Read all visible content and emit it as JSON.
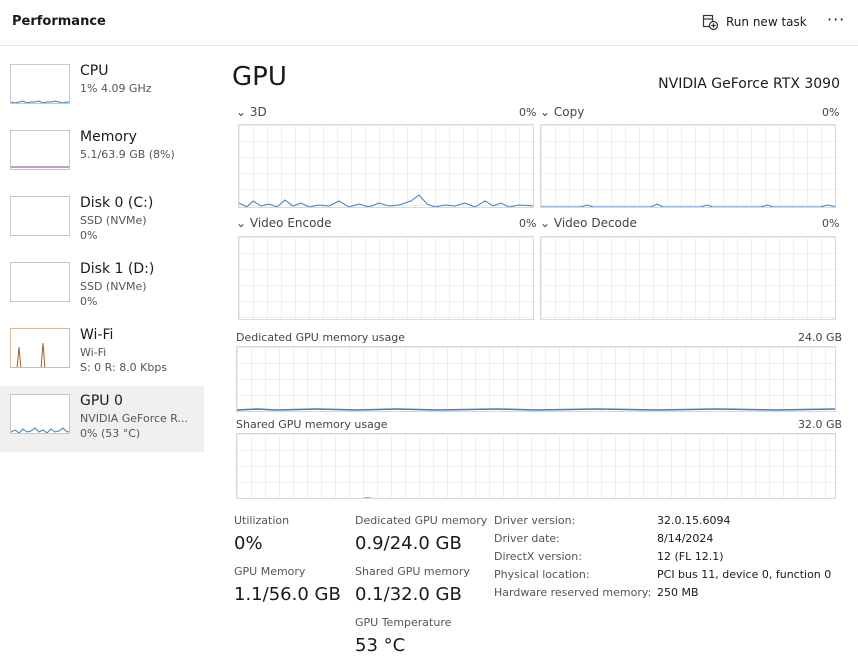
{
  "header": {
    "title": "Performance",
    "run_task_label": "Run new task",
    "more_label": "···"
  },
  "sidebar": {
    "items": [
      {
        "name": "CPU",
        "line1": "1%  4.09 GHz",
        "line2": ""
      },
      {
        "name": "Memory",
        "line1": "5.1/63.9 GB (8%)",
        "line2": ""
      },
      {
        "name": "Disk 0 (C:)",
        "line1": "SSD (NVMe)",
        "line2": "0%"
      },
      {
        "name": "Disk 1 (D:)",
        "line1": "SSD (NVMe)",
        "line2": "0%"
      },
      {
        "name": "Wi-Fi",
        "line1": "Wi-Fi",
        "line2": "S: 0  R: 8.0 Kbps"
      },
      {
        "name": "GPU 0",
        "line1": "NVIDIA GeForce R...",
        "line2": "0%  (53 °C)"
      }
    ]
  },
  "main": {
    "title": "GPU",
    "model": "NVIDIA GeForce RTX 3090",
    "engines": [
      {
        "label": "3D",
        "pct": "0%"
      },
      {
        "label": "Copy",
        "pct": "0%"
      },
      {
        "label": "Video Encode",
        "pct": "0%"
      },
      {
        "label": "Video Decode",
        "pct": "0%"
      }
    ],
    "dedicated_label": "Dedicated GPU memory usage",
    "dedicated_max": "24.0 GB",
    "shared_label": "Shared GPU memory usage",
    "shared_max": "32.0 GB"
  },
  "stats": {
    "utilization_label": "Utilization",
    "utilization": "0%",
    "dedicated_label": "Dedicated GPU memory",
    "dedicated": "0.9/24.0 GB",
    "gpu_memory_label": "GPU Memory",
    "gpu_memory": "1.1/56.0 GB",
    "shared_label": "Shared GPU memory",
    "shared": "0.1/32.0 GB",
    "temp_label": "GPU Temperature",
    "temp": "53 °C"
  },
  "info": {
    "driver_version_label": "Driver version:",
    "driver_version": "32.0.15.6094",
    "driver_date_label": "Driver date:",
    "driver_date": "8/14/2024",
    "directx_label": "DirectX version:",
    "directx": "12 (FL 12.1)",
    "location_label": "Physical location:",
    "location": "PCI bus 11, device 0, function 0",
    "reserved_label": "Hardware reserved memory:",
    "reserved": "250 MB"
  },
  "colors": {
    "gpu_line": "#3b7fc4",
    "memory_line": "#9b2fae",
    "wifi_line": "#a0612a"
  }
}
